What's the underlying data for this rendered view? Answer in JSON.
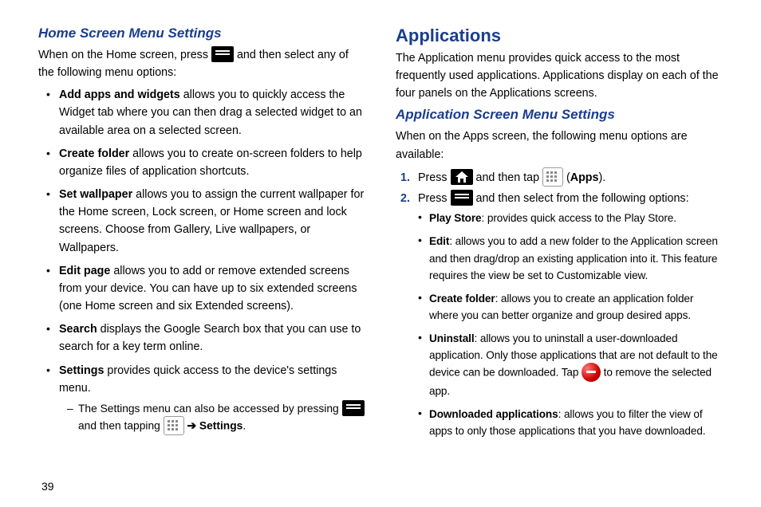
{
  "pageNumber": "39",
  "left": {
    "heading": "Home Screen Menu Settings",
    "intro_a": "When on the Home screen, press ",
    "intro_b": " and then select any of the following menu options:",
    "items": [
      {
        "term": "Add apps and widgets",
        "desc": " allows you to quickly access the Widget tab where you can then drag a selected widget to an available area on a selected screen."
      },
      {
        "term": "Create folder",
        "desc": " allows you to create on-screen folders to help organize files of application shortcuts."
      },
      {
        "term": "Set wallpaper",
        "desc": " allows you to assign the current wallpaper for the Home screen, Lock screen, or Home screen and lock screens. Choose from Gallery, Live wallpapers, or Wallpapers."
      },
      {
        "term": "Edit page",
        "desc": " allows you to add or remove extended screens from your device. You can have up to six extended screens (one Home screen and six Extended screens)."
      },
      {
        "term": "Search",
        "desc": " displays the Google Search box that you can use to search for a key term online."
      },
      {
        "term": "Settings",
        "desc": " provides quick access to the device's settings menu."
      }
    ],
    "sub_a": "The Settings menu can also be accessed by pressing ",
    "sub_b": " and then tapping ",
    "sub_c": "Settings",
    "arrow": "➔"
  },
  "right": {
    "bigHeading": "Applications",
    "appIntro": "The Application menu provides quick access to the most frequently used applications. Applications display on each of the four panels on the Applications screens.",
    "heading": "Application Screen Menu Settings",
    "intro": "When on the Apps screen, the following menu options are available:",
    "step1_a": "Press ",
    "step1_b": " and then tap ",
    "step1_c": " (",
    "step1_d": "Apps",
    "step1_e": ").",
    "step2_a": "Press ",
    "step2_b": " and then select from the following options:",
    "options": [
      {
        "term": "Play Store",
        "desc": ": provides quick access to the Play Store."
      },
      {
        "term": "Edit",
        "desc": ": allows you to add a new folder to the Application screen and then drag/drop an existing application into it. This feature requires the view be set to Customizable view."
      },
      {
        "term": "Create folder",
        "desc": ": allows you to create an application folder where you can better organize and group desired apps."
      },
      {
        "term": "Uninstall",
        "desc_a": ": allows you to uninstall a user-downloaded application. Only those applications that are not default to the device can be downloaded. Tap ",
        "desc_b": " to remove the selected app."
      },
      {
        "term": "Downloaded applications",
        "desc": ": allows you to filter the view of apps to only those applications that you have downloaded."
      }
    ]
  }
}
